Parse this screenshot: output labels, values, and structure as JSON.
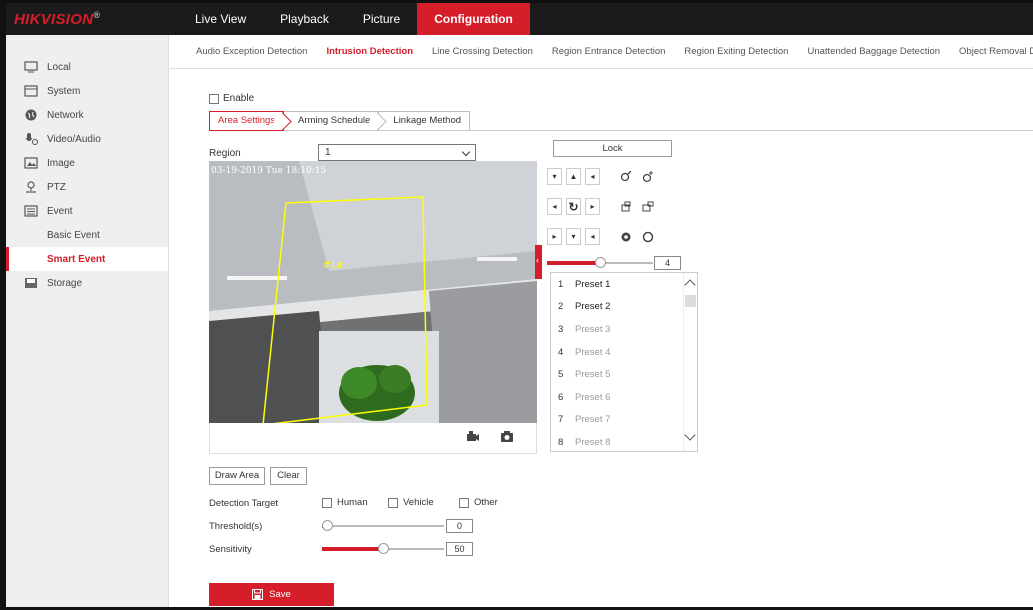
{
  "brand": {
    "logo": "HIKVISION",
    "reg": "®"
  },
  "nav": [
    {
      "label": "Live View"
    },
    {
      "label": "Playback"
    },
    {
      "label": "Picture"
    },
    {
      "label": "Configuration",
      "active": true
    }
  ],
  "sidebar": {
    "items": [
      {
        "label": "Local",
        "icon": "monitor-icon"
      },
      {
        "label": "System",
        "icon": "window-icon"
      },
      {
        "label": "Network",
        "icon": "globe-icon"
      },
      {
        "label": "Video/Audio",
        "icon": "microphone-icon"
      },
      {
        "label": "Image",
        "icon": "image-icon"
      },
      {
        "label": "PTZ",
        "icon": "ptz-icon"
      },
      {
        "label": "Event",
        "icon": "calendar-icon"
      },
      {
        "label": "Basic Event",
        "sub": true
      },
      {
        "label": "Smart Event",
        "sub": true,
        "active": true
      },
      {
        "label": "Storage",
        "icon": "disk-icon"
      }
    ]
  },
  "subtabs": [
    "Audio Exception Detection",
    "Intrusion Detection",
    "Line Crossing Detection",
    "Region Entrance Detection",
    "Region Exiting Detection",
    "Unattended Baggage Detection",
    "Object Removal Detection"
  ],
  "active_subtab": "Intrusion Detection",
  "enable_label": "Enable",
  "steps": [
    "Area Settings",
    "Arming Schedule",
    "Linkage Method"
  ],
  "region": {
    "label": "Region",
    "value": "1"
  },
  "video": {
    "timestamp": "03-19-2019 Tue 18:10:15",
    "area_tag": "#1#"
  },
  "ptz": {
    "lock_label": "Lock",
    "speed_value": "4",
    "speed_fraction": 0.5
  },
  "presets": [
    {
      "n": "1",
      "label": "Preset 1",
      "enabled": true
    },
    {
      "n": "2",
      "label": "Preset 2",
      "enabled": true
    },
    {
      "n": "3",
      "label": "Preset 3",
      "enabled": false
    },
    {
      "n": "4",
      "label": "Preset 4",
      "enabled": false
    },
    {
      "n": "5",
      "label": "Preset 5",
      "enabled": false
    },
    {
      "n": "6",
      "label": "Preset 6",
      "enabled": false
    },
    {
      "n": "7",
      "label": "Preset 7",
      "enabled": false
    },
    {
      "n": "8",
      "label": "Preset 8",
      "enabled": false
    }
  ],
  "draw_area_label": "Draw Area",
  "clear_label": "Clear",
  "detection_target": {
    "label": "Detection Target",
    "options": [
      "Human",
      "Vehicle",
      "Other"
    ]
  },
  "threshold": {
    "label": "Threshold(s)",
    "value": "0",
    "fraction": 0.0
  },
  "sensitivity": {
    "label": "Sensitivity",
    "value": "50",
    "fraction": 0.5
  },
  "save_label": "Save",
  "colors": {
    "accent": "#d61e2a",
    "topbar": "#1b1b1b",
    "overlay": "#ffff00"
  }
}
